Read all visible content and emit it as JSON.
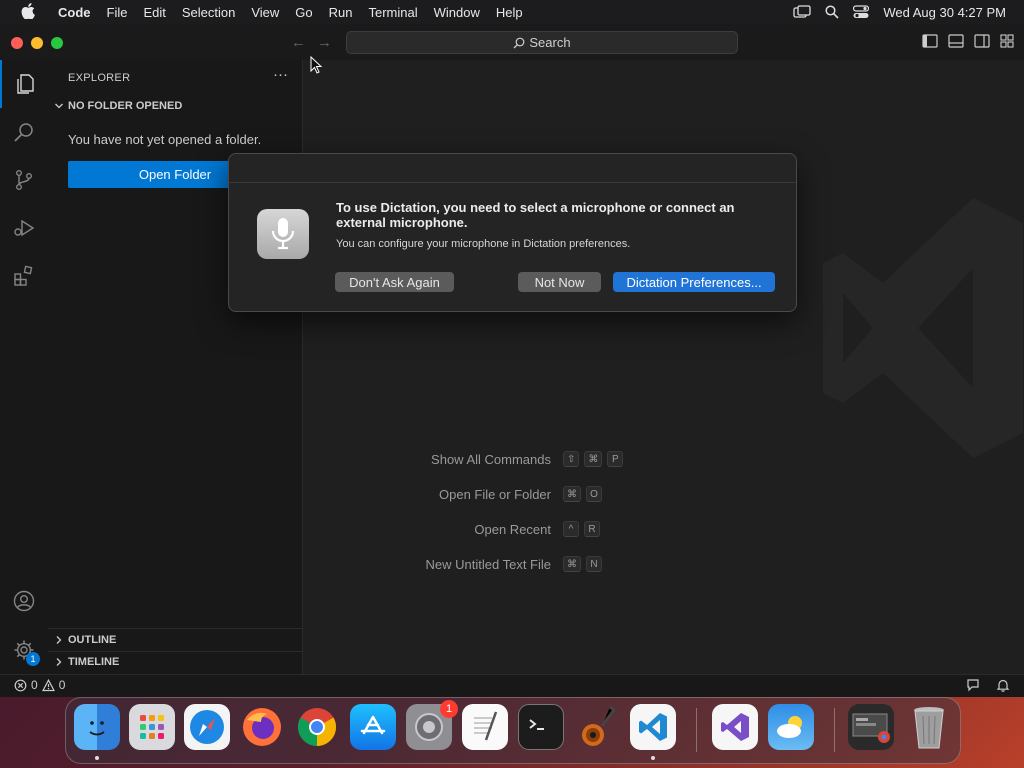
{
  "menubar": {
    "app": "Code",
    "items": [
      "File",
      "Edit",
      "Selection",
      "View",
      "Go",
      "Run",
      "Terminal",
      "Window",
      "Help"
    ],
    "clock": "Wed Aug 30  4:27 PM"
  },
  "titlebar": {
    "search_label": "Search"
  },
  "sidebar": {
    "title": "EXPLORER",
    "more": "···",
    "section_no_folder": "NO FOLDER OPENED",
    "message": "You have not yet opened a folder.",
    "open_folder_label": "Open Folder",
    "section_outline": "OUTLINE",
    "section_timeline": "TIMELINE"
  },
  "activity": {
    "settings_badge": "1"
  },
  "editor": {
    "commands": [
      {
        "label": "Show All Commands",
        "keys": [
          "⇧",
          "⌘",
          "P"
        ]
      },
      {
        "label": "Open File or Folder",
        "keys": [
          "⌘",
          "O"
        ]
      },
      {
        "label": "Open Recent",
        "keys": [
          "^",
          "R"
        ]
      },
      {
        "label": "New Untitled Text File",
        "keys": [
          "⌘",
          "N"
        ]
      }
    ]
  },
  "statusbar": {
    "errors": "0",
    "warnings": "0"
  },
  "dialog": {
    "title": "To use Dictation, you need to select a microphone or connect an external microphone.",
    "body": "You can configure your microphone in Dictation preferences.",
    "btn_dont_ask": "Don't Ask Again",
    "btn_not_now": "Not Now",
    "btn_prefs": "Dictation Preferences..."
  },
  "dock": {
    "apps": [
      "Finder",
      "Launchpad",
      "Safari",
      "Firefox",
      "Chrome",
      "App Store",
      "System Settings",
      "TextEdit",
      "Terminal",
      "GarageBand",
      "Visual Studio Code",
      "Visual Studio",
      "Weather",
      "Downloads",
      "Trash"
    ],
    "settings_badge": "1"
  },
  "colors": {
    "accent": "#0078d4",
    "dialog_primary": "#1f74d6"
  }
}
